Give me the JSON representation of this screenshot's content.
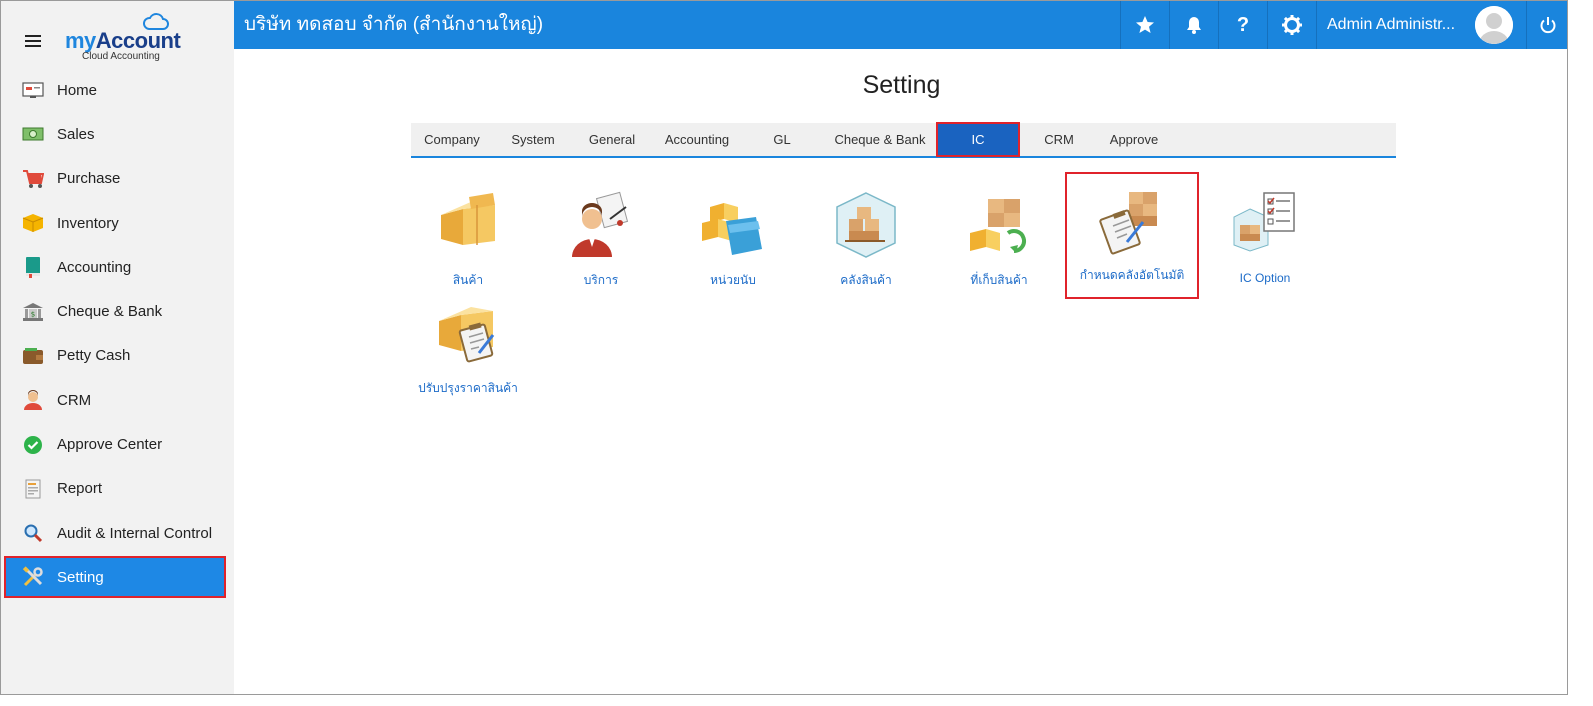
{
  "brand": {
    "logo_my": "my",
    "logo_account": "Account",
    "logo_sub": "Cloud Accounting"
  },
  "sidebar": {
    "items": [
      {
        "label": "Home",
        "icon": "home-icon"
      },
      {
        "label": "Sales",
        "icon": "sales-icon"
      },
      {
        "label": "Purchase",
        "icon": "cart-icon"
      },
      {
        "label": "Inventory",
        "icon": "box-icon"
      },
      {
        "label": "Accounting",
        "icon": "ledger-icon"
      },
      {
        "label": "Cheque & Bank",
        "icon": "bank-icon"
      },
      {
        "label": "Petty Cash",
        "icon": "wallet-icon"
      },
      {
        "label": "CRM",
        "icon": "person-icon"
      },
      {
        "label": "Approve Center",
        "icon": "check-circle-icon"
      },
      {
        "label": "Report",
        "icon": "report-icon"
      },
      {
        "label": "Audit & Internal Control",
        "icon": "magnifier-icon"
      },
      {
        "label": "Setting",
        "icon": "tools-icon"
      }
    ],
    "active": "Setting"
  },
  "header": {
    "company": "บริษัท ทดสอบ จำกัด (สำนักงานใหญ่)",
    "user_name": "Admin Administr...",
    "help_glyph": "?",
    "colors": {
      "bar": "#1a85dd",
      "active": "#1e88e5",
      "highlight": "#e0232b"
    }
  },
  "main": {
    "title": "Setting",
    "tabs": [
      "Company",
      "System",
      "General",
      "Accounting",
      "GL",
      "Cheque & Bank",
      "IC",
      "CRM",
      "Approve"
    ],
    "active_tab": "IC",
    "tiles": [
      {
        "label": "สินค้า",
        "icon": "product-boxes-icon"
      },
      {
        "label": "บริการ",
        "icon": "service-person-icon"
      },
      {
        "label": "หน่วยนับ",
        "icon": "unit-folder-icon"
      },
      {
        "label": "คลังสินค้า",
        "icon": "warehouse-icon"
      },
      {
        "label": "ที่เก็บสินค้า",
        "icon": "storage-location-icon"
      },
      {
        "label": "กำหนดคลังอัตโนมัติ",
        "icon": "auto-warehouse-icon"
      },
      {
        "label": "IC Option",
        "icon": "ic-option-icon"
      },
      {
        "label": "ปรับปรุงราคาสินค้า",
        "icon": "price-adjust-icon"
      }
    ],
    "highlighted_tile": "กำหนดคลังอัตโนมัติ"
  }
}
